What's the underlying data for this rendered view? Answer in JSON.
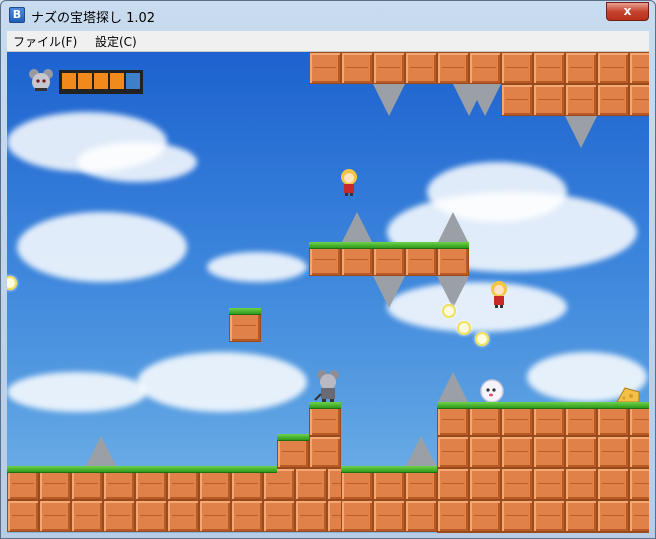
{
  "window": {
    "title": "ナズの宝塔探し 1.02",
    "close_label": "x"
  },
  "menu": {
    "items": [
      {
        "label": "ファイル(F)"
      },
      {
        "label": "設定(C)"
      }
    ]
  },
  "hud": {
    "health_total": 5,
    "health_filled": 4,
    "colors": {
      "filled": "#f08a1c",
      "empty": "#3d7fc9"
    }
  },
  "icons": [
    "app-icon",
    "mouse-face-icon",
    "girl-sprite",
    "ghost-sprite",
    "treasure-cheese-icon",
    "spike-icon"
  ]
}
